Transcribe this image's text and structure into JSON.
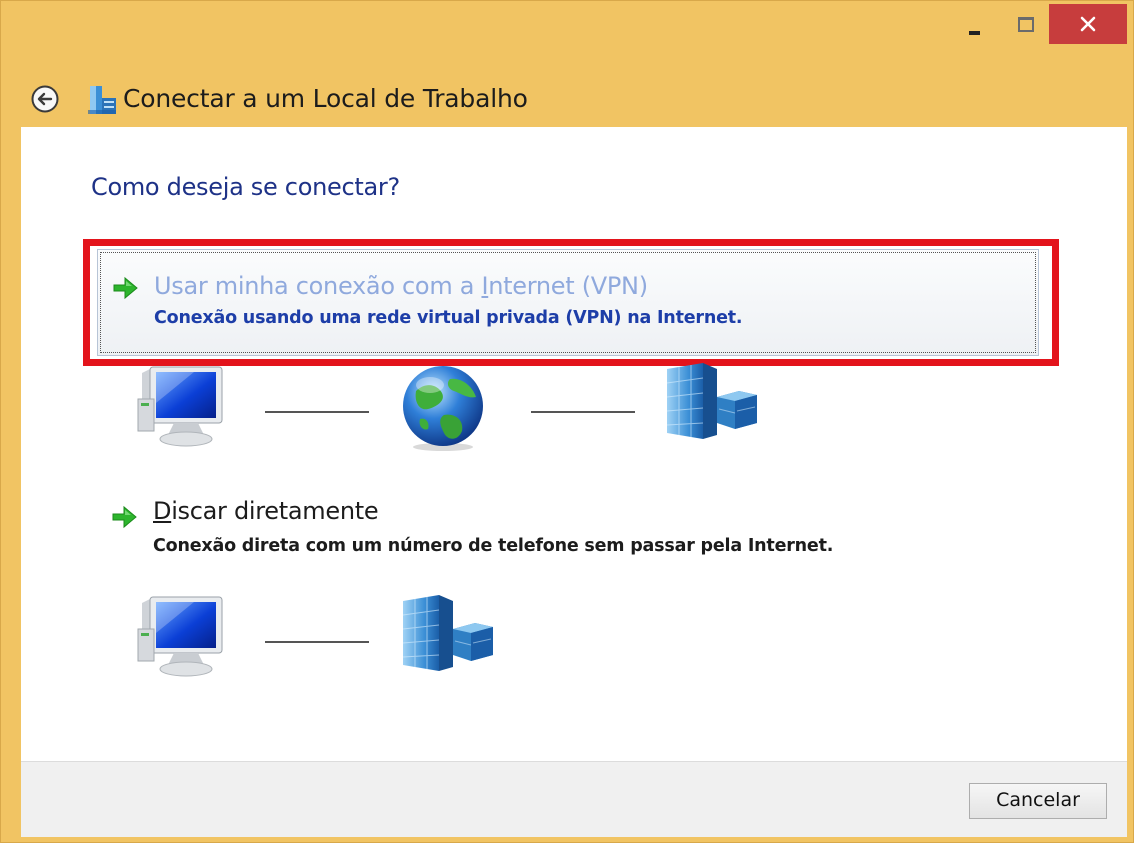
{
  "window": {
    "title": "Conectar a um Local de Trabalho",
    "controls": [
      "minimize",
      "maximize",
      "close"
    ],
    "accent_color": "#f1c463",
    "close_color": "#c73d3d"
  },
  "content": {
    "heading": "Como deseja se conectar?",
    "options": [
      {
        "title": "Usar minha conexão com a Internet (VPN)",
        "title_pre": "Usar minha conexão com a ",
        "title_access_key": "I",
        "title_post": "nternet (VPN)",
        "description": "Conexão usando uma rede virtual privada (VPN) na Internet.",
        "selected": true,
        "highlighted": true,
        "diagram": [
          "computer-icon",
          "globe-icon",
          "office-building-icon"
        ]
      },
      {
        "title": "Discar diretamente",
        "title_access_key": "D",
        "title_post": "iscar diretamente",
        "description": "Conexão direta com um número de telefone sem passar pela Internet.",
        "diagram": [
          "computer-icon",
          "office-building-icon"
        ]
      }
    ]
  },
  "footer": {
    "cancel_label": "Cancelar"
  },
  "colors": {
    "heading": "#1e3287",
    "link_description": "#1d3ea8",
    "highlight_border": "#e3141c",
    "arrow_green": "#2db52d"
  }
}
